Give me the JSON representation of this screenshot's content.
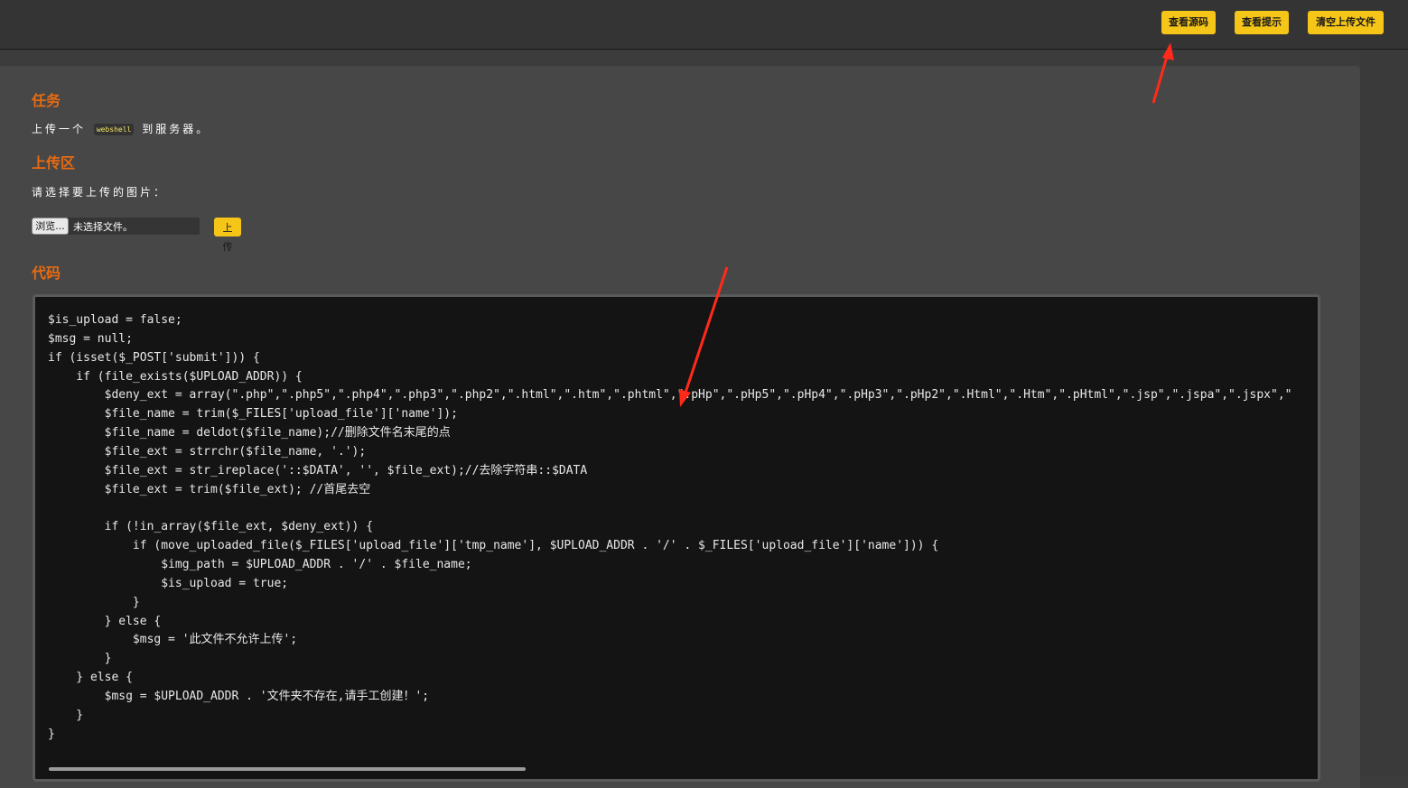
{
  "header": {
    "view_source_label": "查看源码",
    "view_hint_label": "查看提示",
    "clear_uploads_label": "清空上传文件"
  },
  "task": {
    "title": "任务",
    "text_before": "上传一个",
    "code_word": "webshell",
    "text_after": "到服务器。"
  },
  "upload": {
    "title": "上传区",
    "prompt": "请选择要上传的图片：",
    "browse_label": "浏览...",
    "no_file_text": "未选择文件。",
    "submit_label": "上传"
  },
  "code": {
    "title": "代码",
    "lines": [
      "$is_upload = false;",
      "$msg = null;",
      "if (isset($_POST['submit'])) {",
      "    if (file_exists($UPLOAD_ADDR)) {",
      "        $deny_ext = array(\".php\",\".php5\",\".php4\",\".php3\",\".php2\",\".html\",\".htm\",\".phtml\",\".pHp\",\".pHp5\",\".pHp4\",\".pHp3\",\".pHp2\",\".Html\",\".Htm\",\".pHtml\",\".jsp\",\".jspa\",\".jspx\",\"",
      "        $file_name = trim($_FILES['upload_file']['name']);",
      "        $file_name = deldot($file_name);//删除文件名末尾的点",
      "        $file_ext = strrchr($file_name, '.');",
      "        $file_ext = str_ireplace('::$DATA', '', $file_ext);//去除字符串::$DATA",
      "        $file_ext = trim($file_ext); //首尾去空",
      "",
      "        if (!in_array($file_ext, $deny_ext)) {",
      "            if (move_uploaded_file($_FILES['upload_file']['tmp_name'], $UPLOAD_ADDR . '/' . $_FILES['upload_file']['name'])) {",
      "                $img_path = $UPLOAD_ADDR . '/' . $file_name;",
      "                $is_upload = true;",
      "            }",
      "        } else {",
      "            $msg = '此文件不允许上传';",
      "        }",
      "    } else {",
      "        $msg = $UPLOAD_ADDR . '文件夹不存在,请手工创建！';",
      "    }",
      "}"
    ]
  },
  "colors": {
    "accent": "#f5c518",
    "heading": "#e86b12",
    "annotation_arrow": "#ff2a1a"
  }
}
